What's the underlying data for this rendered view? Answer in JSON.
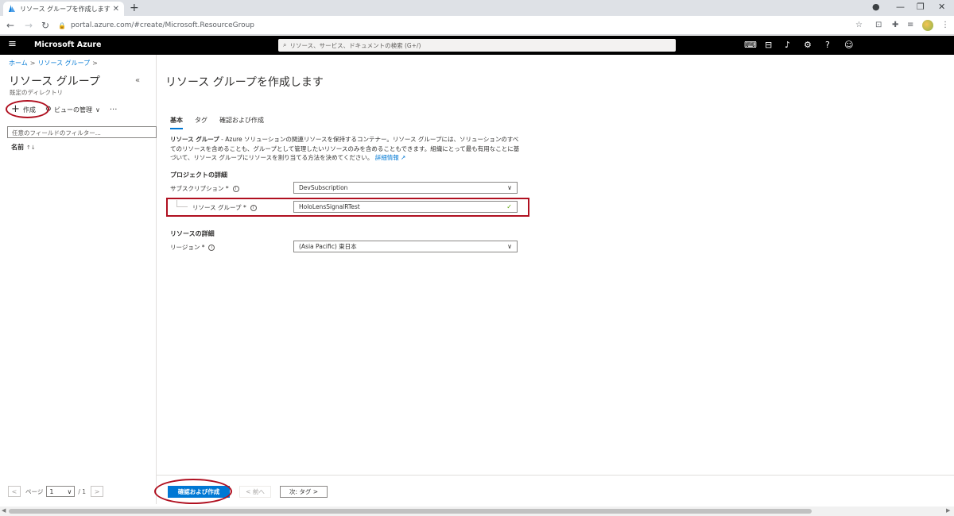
{
  "browser": {
    "tab_title": "リソース グループを作成します - Micro",
    "url": "portal.azure.com/#create/Microsoft.ResourceGroup"
  },
  "azure": {
    "brand": "Microsoft Azure",
    "search_placeholder": "リソース、サービス、ドキュメントの検索 (G+/)"
  },
  "left_pane": {
    "breadcrumb": [
      "ホーム",
      "リソース グループ"
    ],
    "title": "リソース グループ",
    "subtitle": "既定のディレクトリ",
    "create_label": "作成",
    "manage_view_label": "ビューの管理",
    "filter_placeholder": "任意のフィールドのフィルター...",
    "column_name": "名前",
    "pager": {
      "label": "ページ",
      "current": "1",
      "total": "/ 1"
    }
  },
  "main": {
    "title": "リソース グループを作成します",
    "tabs": [
      "基本",
      "タグ",
      "確認および作成"
    ],
    "description": {
      "bold": "リソース グループ",
      "text": " - Azure ソリューションの関連リソースを保持するコンテナー。リソース グループには、ソリューションのすべてのリソースを含めることも、グループとして管理したいリソースのみを含めることもできます。組織にとって最も有用なことに基づいて、リソース グループにリソースを割り当てる方法を決めてください。",
      "link": "詳細情報"
    },
    "project_section": "プロジェクトの詳細",
    "subscription_label": "サブスクリプション *",
    "subscription_value": "DevSubscription",
    "resource_group_label": "リソース グループ *",
    "resource_group_value": "HoloLensSignalRTest",
    "resource_section": "リソースの詳細",
    "region_label": "リージョン *",
    "region_value": "(Asia Pacific) 東日本"
  },
  "footer": {
    "review_create": "確認および作成",
    "previous": "< 前へ",
    "next": "次: タグ >"
  },
  "colors": {
    "primary": "#0078d4",
    "annotation_red": "#b01020",
    "header_bg": "#000000"
  }
}
